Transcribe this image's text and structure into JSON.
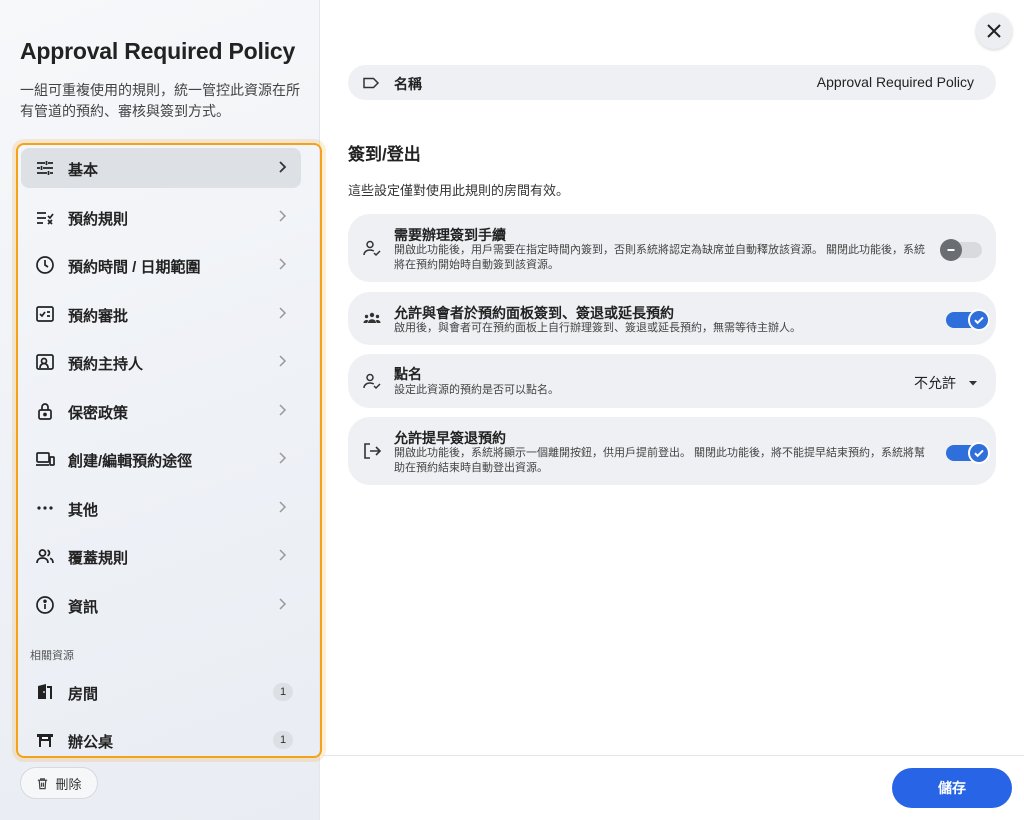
{
  "dialog": {
    "title": "Approval Required Policy",
    "description": "一組可重複使用的規則，統一管控此資源在所有管道的預約、審核與簽到方式。"
  },
  "nav": {
    "items": [
      {
        "label": "基本",
        "icon": "sliders-icon"
      },
      {
        "label": "預約規則",
        "icon": "checklist-icon"
      },
      {
        "label": "預約時間 / 日期範圍",
        "icon": "clock-icon"
      },
      {
        "label": "預約審批",
        "icon": "approval-icon"
      },
      {
        "label": "預約主持人",
        "icon": "host-icon"
      },
      {
        "label": "保密政策",
        "icon": "lock-icon"
      },
      {
        "label": "創建/編輯預約途徑",
        "icon": "devices-icon"
      },
      {
        "label": "其他",
        "icon": "more-icon"
      },
      {
        "label": "覆蓋規則",
        "icon": "people-icon"
      },
      {
        "label": "資訊",
        "icon": "info-icon"
      }
    ],
    "related_label": "相關資源",
    "related": [
      {
        "label": "房間",
        "count": "1",
        "icon": "door-icon"
      },
      {
        "label": "辦公桌",
        "count": "1",
        "icon": "desk-icon"
      }
    ]
  },
  "actions": {
    "delete_label": "刪除",
    "save_label": "儲存"
  },
  "name_field": {
    "label": "名稱",
    "value": "Approval Required Policy"
  },
  "section": {
    "title": "簽到/登出",
    "description": "這些設定僅對使用此規則的房間有效。"
  },
  "settings": [
    {
      "title": "需要辦理簽到手續",
      "description": "開啟此功能後，用戶需要在指定時間內簽到，否則系統將認定為缺席並自動釋放該資源。 關閉此功能後，系統將在預約開始時自動簽到該資源。",
      "enabled": false
    },
    {
      "title": "允許與會者於預約面板簽到、簽退或延長預約",
      "description": "啟用後，與會者可在預約面板上自行辦理簽到、簽退或延長預約，無需等待主辦人。",
      "enabled": true
    },
    {
      "title": "點名",
      "description": "設定此資源的預約是否可以點名。",
      "selected": "不允許"
    },
    {
      "title": "允許提早簽退預約",
      "description": "開啟此功能後，系統將顯示一個離開按鈕，供用戶提前登出。 關閉此功能後，將不能提早結束預約，系統將幫助在預約結束時自動登出資源。",
      "enabled": true
    }
  ],
  "colors": {
    "accent": "#2864e6",
    "highlight": "#f5a21b"
  }
}
